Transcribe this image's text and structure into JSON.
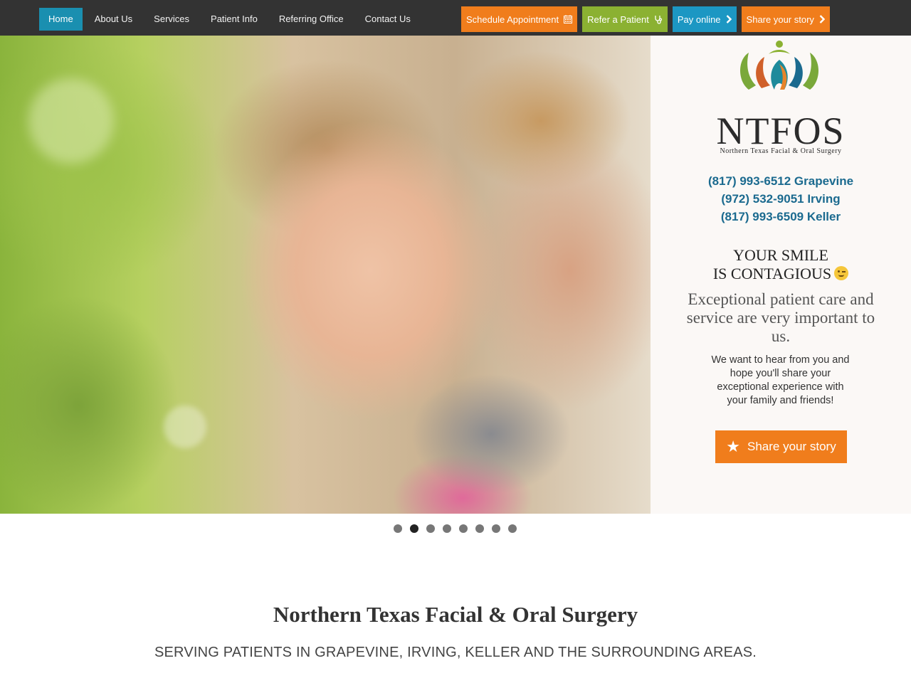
{
  "nav": {
    "items": [
      {
        "label": "Home",
        "active": true
      },
      {
        "label": "About Us"
      },
      {
        "label": "Services"
      },
      {
        "label": "Patient Info"
      },
      {
        "label": "Referring Office"
      },
      {
        "label": "Contact Us"
      }
    ]
  },
  "ctas": {
    "schedule": {
      "label": "Schedule Appointment",
      "icon": "calendar-icon",
      "color": "#f07d1c"
    },
    "refer": {
      "label": "Refer a Patient",
      "icon": "stethoscope-icon",
      "color": "#8bb132"
    },
    "pay": {
      "label": "Pay online",
      "icon": "chevron-right-icon",
      "color": "#1c97c3"
    },
    "share": {
      "label": "Share your story",
      "icon": "chevron-right-icon",
      "color": "#f07d1c"
    }
  },
  "hero": {
    "brand": "NTFOS",
    "brand_sub": "Northern Texas Facial & Oral Surgery",
    "phones": [
      "(817) 993-6512 Grapevine",
      "(972) 532-9051 Irving",
      "(817) 993-6509 Keller"
    ],
    "smile_line1": "YOUR SMILE",
    "smile_line2": "IS CONTAGIOUS",
    "care": "Exceptional patient care and service are very important to us.",
    "hear": "We want to hear from you and hope you'll share your exceptional experience with your family and friends!",
    "share_button": "Share your story",
    "phone_color": "#1b6a8f"
  },
  "slider": {
    "count": 8,
    "active_index": 1
  },
  "intro": {
    "title": "Northern Texas Facial & Oral Surgery",
    "subtitle": "SERVING PATIENTS IN GRAPEVINE, IRVING, KELLER AND THE SURROUNDING AREAS."
  }
}
